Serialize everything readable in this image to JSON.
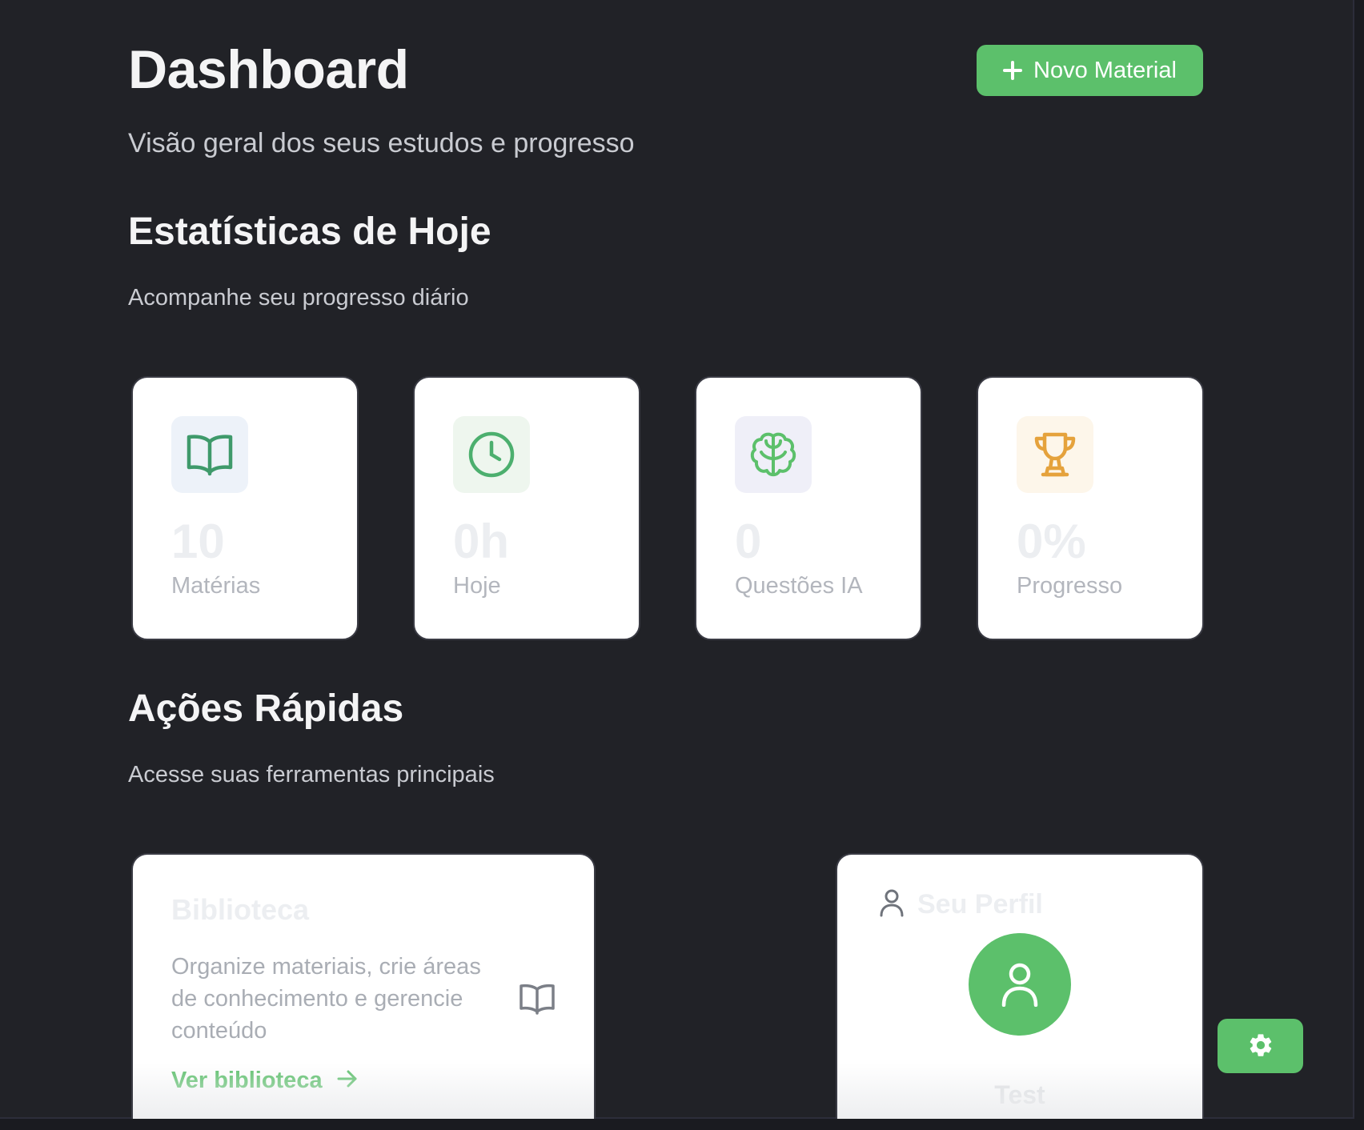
{
  "header": {
    "title": "Dashboard",
    "subtitle": "Visão geral dos seus estudos e progresso",
    "new_material_label": "Novo Material"
  },
  "stats_section": {
    "title": "Estatísticas de Hoje",
    "subtitle": "Acompanhe seu progresso diário",
    "cards": [
      {
        "icon": "book-open-icon",
        "value": "10",
        "label": "Matérias",
        "icon_color": "#3f9a6b",
        "icon_bg": "#edf2f9"
      },
      {
        "icon": "clock-icon",
        "value": "0h",
        "label": "Hoje",
        "icon_color": "#4caf6e",
        "icon_bg": "#eef6ee"
      },
      {
        "icon": "brain-icon",
        "value": "0",
        "label": "Questões IA",
        "icon_color": "#5cc06b",
        "icon_bg": "#efeff8"
      },
      {
        "icon": "trophy-icon",
        "value": "0%",
        "label": "Progresso",
        "icon_color": "#e5a23c",
        "icon_bg": "#fdf6ea"
      }
    ]
  },
  "actions_section": {
    "title": "Ações Rápidas",
    "subtitle": "Acesse suas ferramentas principais",
    "library": {
      "title": "Biblioteca",
      "description": "Organize materiais, crie áreas de conhecimento e gerencie conteúdo",
      "link_label": "Ver biblioteca",
      "icon": "book-open-icon"
    },
    "profile": {
      "title": "Seu Perfil",
      "name": "Test",
      "icon": "user-icon"
    }
  },
  "settings_button": {
    "icon": "gear-icon"
  },
  "colors": {
    "background": "#212227",
    "accent_green": "#5cc06b",
    "card_background": "#ffffff"
  }
}
